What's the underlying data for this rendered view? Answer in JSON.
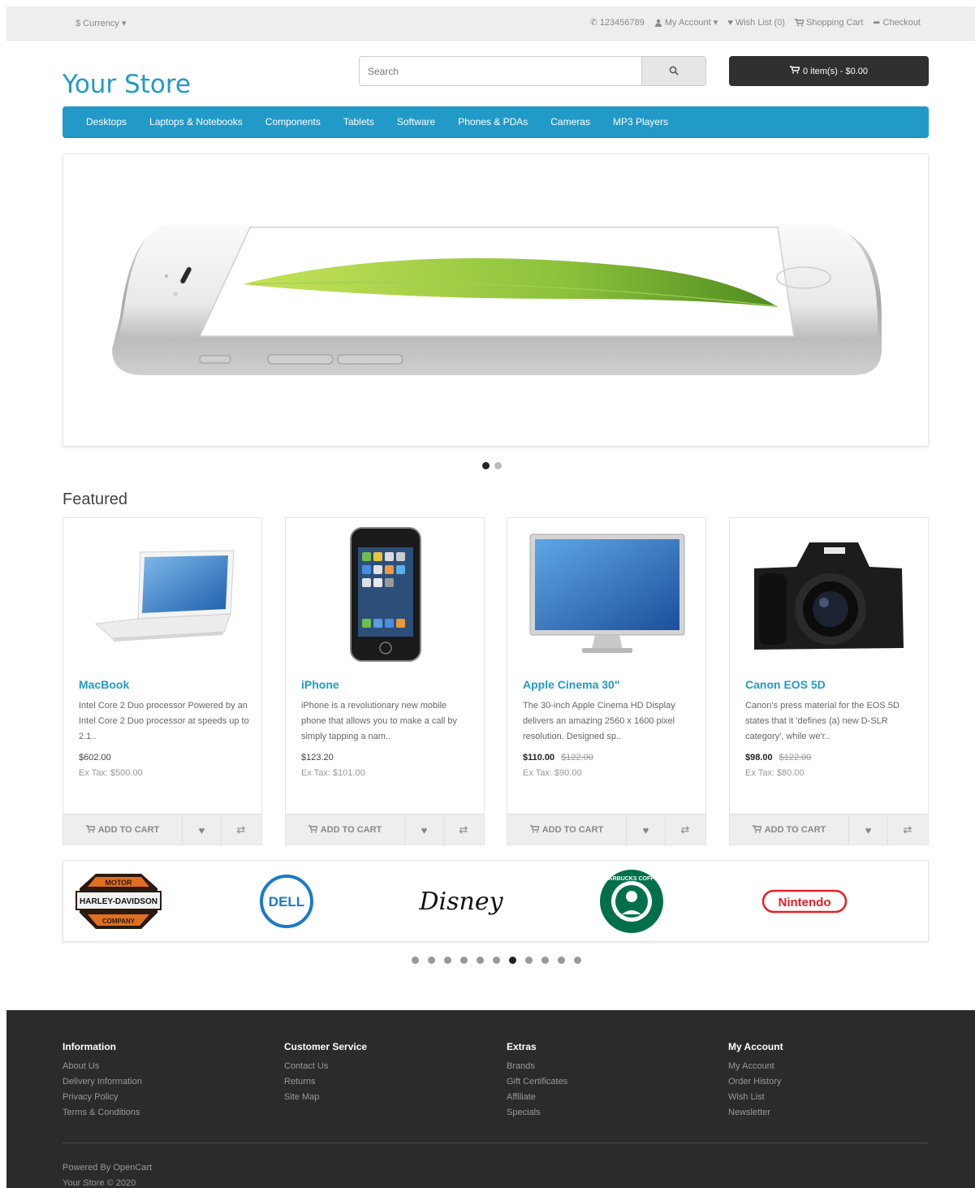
{
  "topbar": {
    "currency": "$ Currency ▾",
    "phone": "123456789",
    "my_account": "My Account ▾",
    "wishlist": "Wish List (0)",
    "shopping_cart": "Shopping Cart",
    "checkout": "Checkout"
  },
  "header": {
    "logo": "Your Store",
    "search_placeholder": "Search",
    "cart_label": "0 item(s) - $0.00"
  },
  "nav": [
    "Desktops",
    "Laptops & Notebooks",
    "Components",
    "Tablets",
    "Software",
    "Phones & PDAs",
    "Cameras",
    "MP3 Players"
  ],
  "featured_title": "Featured",
  "products": [
    {
      "name": "MacBook",
      "desc": "Intel Core 2 Duo processor Powered by an Intel Core 2 Duo processor at speeds up to 2.1..",
      "price": "$602.00",
      "old_price": "",
      "tax": "Ex Tax: $500.00"
    },
    {
      "name": "iPhone",
      "desc": "iPhone is a revolutionary new mobile phone that allows you to make a call by simply tapping a nam..",
      "price": "$123.20",
      "old_price": "",
      "tax": "Ex Tax: $101.00"
    },
    {
      "name": "Apple Cinema 30\"",
      "desc": "The 30-inch Apple Cinema HD Display delivers an amazing 2560 x 1600 pixel resolution. Designed sp..",
      "price": "$110.00",
      "old_price": "$122.00",
      "tax": "Ex Tax: $90.00"
    },
    {
      "name": "Canon EOS 5D",
      "desc": "Canon's press material for the EOS 5D states that it 'defines (a) new D-SLR category', while we'r..",
      "price": "$98.00",
      "old_price": "$122.00",
      "tax": "Ex Tax: $80.00"
    }
  ],
  "add_to_cart": "ADD TO CART",
  "brands": [
    "HARLEY-DAVIDSON",
    "DELL",
    "Disney",
    "STARBUCKS COFFEE",
    "Nintendo"
  ],
  "harley_text": {
    "top": "MOTOR",
    "mid": "HARLEY-DAVIDSON",
    "bot": "COMPANY"
  },
  "footer": {
    "columns": [
      {
        "title": "Information",
        "links": [
          "About Us",
          "Delivery Information",
          "Privacy Policy",
          "Terms & Conditions"
        ]
      },
      {
        "title": "Customer Service",
        "links": [
          "Contact Us",
          "Returns",
          "Site Map"
        ]
      },
      {
        "title": "Extras",
        "links": [
          "Brands",
          "Gift Certificates",
          "Affiliate",
          "Specials"
        ]
      },
      {
        "title": "My Account",
        "links": [
          "My Account",
          "Order History",
          "Wish List",
          "Newsletter"
        ]
      }
    ],
    "powered": "Powered By OpenCart",
    "copyright": "Your Store © 2020"
  },
  "colors": {
    "accent": "#229ac8",
    "footer_bg": "#2b2b2b",
    "cart_button": "#303030"
  }
}
